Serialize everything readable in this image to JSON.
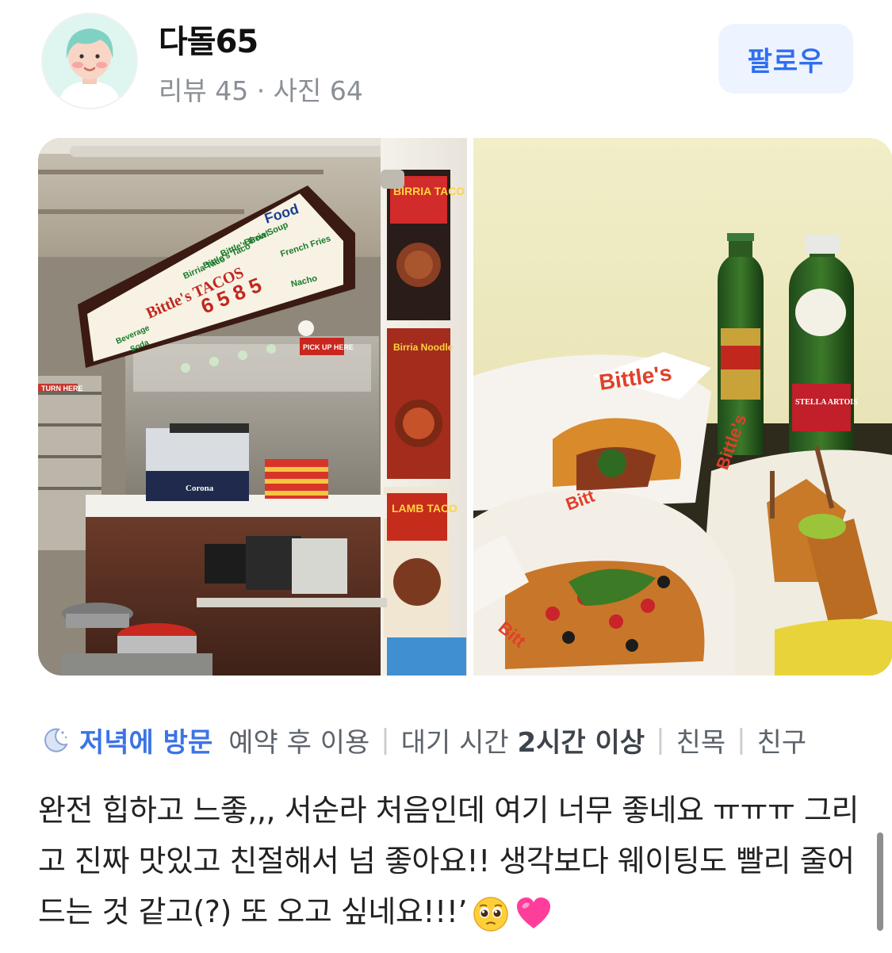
{
  "user": {
    "name": "다돌65",
    "stats": "리뷰 45 · 사진 64"
  },
  "follow_button": {
    "label": "팔로우"
  },
  "photos": [
    {
      "signs": {
        "food_header": "Food",
        "menu_items": [
          "Birria Taco",
          "Bittle's Taco",
          "Bittle's Bowl",
          "Birria Soup",
          "French Fries",
          "Nacho"
        ],
        "brand": "Bittle's TACOS",
        "beverage": "Beverage",
        "soda": "Soda",
        "pickup": "PICK UP HERE",
        "turn": "TURN HERE",
        "poster_1": "BIRRIA TACO",
        "poster_2": "Birria Noodle",
        "poster_3": "LAMB TACO",
        "cooler_brand": "Corona"
      }
    },
    {
      "labels": {
        "basket_print": "Bittle's",
        "beer_2": "STELLA ARTOIS"
      }
    }
  ],
  "visit": {
    "time": "저녁에 방문",
    "tags": [
      {
        "text": "예약 후 이용"
      },
      {
        "label": "대기 시간",
        "value": "2시간 이상"
      },
      {
        "text": "친목"
      },
      {
        "text": "친구"
      }
    ]
  },
  "review": {
    "text": "완전 힙하고 느좋,,, 서순라 처음인데 여기 너무 좋네요 ㅠㅠㅠ 그리고 진짜 맛있고 친절해서 넘 좋아요!! 생각보다 웨이팅도 빨리 줄어드는 것 같고(?) 또 오고 싶네요!!!’",
    "emojis": [
      "pleading-face-emoji",
      "pink-heart-emoji"
    ]
  },
  "colors": {
    "accent_blue": "#3b74e6",
    "follow_bg": "#eef4ff",
    "heart_pink": "#ff3d9a"
  }
}
